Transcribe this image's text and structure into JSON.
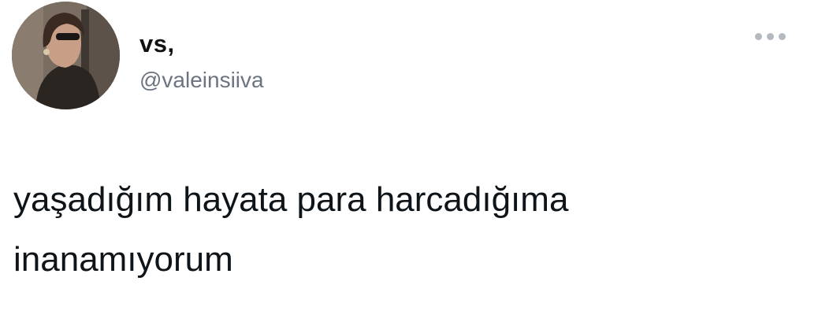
{
  "tweet": {
    "author": {
      "display_name": "vs,",
      "handle": "@valeinsiiva"
    },
    "text": "yaşadığım hayata para harcadığıma inanamıyorum",
    "more_icon": "ellipsis-icon"
  }
}
